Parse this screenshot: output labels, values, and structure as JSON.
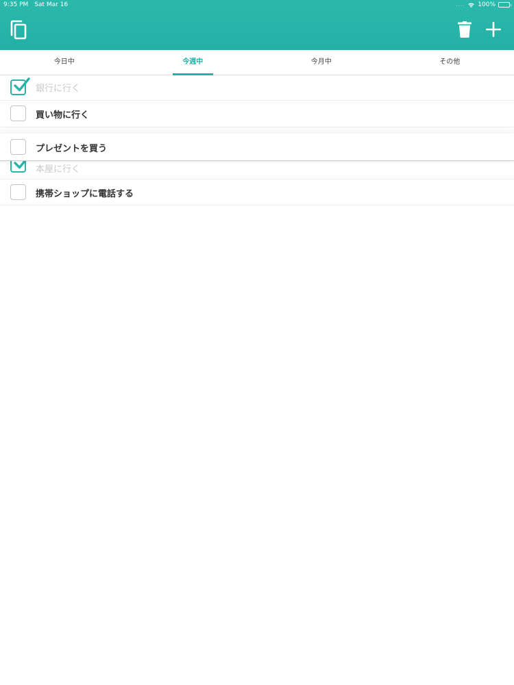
{
  "status_bar": {
    "time": "9:35 PM",
    "date": "Sat Mar 16",
    "signal": "....",
    "battery": "100%"
  },
  "colors": {
    "accent": "#22b3a6",
    "header": "#23b1a7",
    "checked": "#2bb3a8"
  },
  "toolbar": {
    "copy_icon": "copy-icon",
    "trash_icon": "trash-icon",
    "add_icon": "plus-icon"
  },
  "tabs": [
    {
      "label": "今日中",
      "active": false
    },
    {
      "label": "今週中",
      "active": true
    },
    {
      "label": "今月中",
      "active": false
    },
    {
      "label": "その他",
      "active": false
    }
  ],
  "tasks": [
    {
      "label": "銀行に行く",
      "done": true
    },
    {
      "label": "買い物に行く",
      "done": false
    },
    {
      "label": "プレゼントを買う",
      "done": false,
      "dragging": true
    },
    {
      "label": "本屋に行く",
      "done": true
    },
    {
      "label": "携帯ショップに電話する",
      "done": false
    }
  ]
}
